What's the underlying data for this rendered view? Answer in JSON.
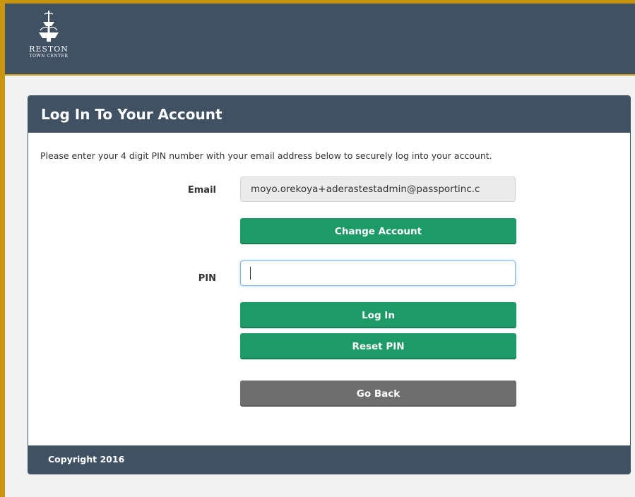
{
  "brand": {
    "name": "RESTON",
    "subtitle": "TOWN CENTER"
  },
  "login": {
    "title": "Log In To Your Account",
    "instructions": "Please enter your 4 digit PIN number with your email address below to securely log into your account.",
    "email_label": "Email",
    "email_value": "moyo.orekoya+aderastestadmin@passportinc.c",
    "change_account_label": "Change Account",
    "pin_label": "PIN",
    "pin_value": "",
    "login_label": "Log In",
    "reset_pin_label": "Reset PIN",
    "go_back_label": "Go Back"
  },
  "footer": {
    "copyright": "Copyright 2016"
  },
  "colors": {
    "header_bg": "#3f5163",
    "accent_border": "#c9950f",
    "button_green": "#1d9b66",
    "button_grey": "#6e6e6e"
  },
  "icons": {
    "logo": "fountain-logo-icon"
  }
}
